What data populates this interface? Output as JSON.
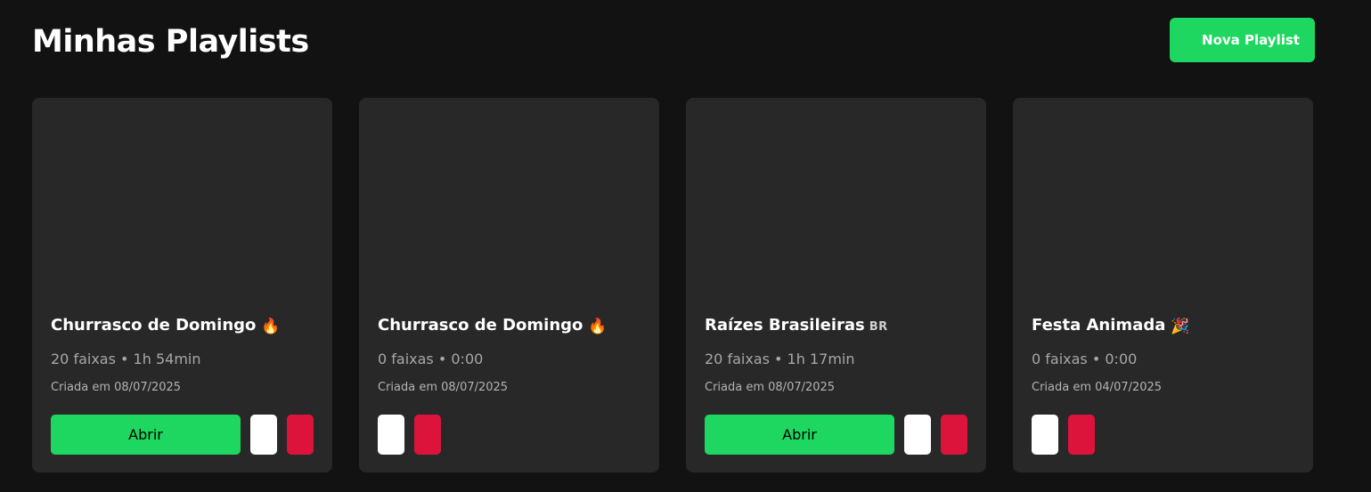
{
  "header": {
    "title": "Minhas Playlists",
    "new_playlist_label": "Nova Playlist"
  },
  "colors": {
    "background": "#121212",
    "card": "#282828",
    "accent": "#1ed760",
    "danger": "#dc143c",
    "edit": "#ffffff"
  },
  "playlists": [
    {
      "name": "Churrasco de Domingo",
      "emoji": "🔥",
      "meta": "20 faixas • 1h 54min",
      "created": "Criada em 08/07/2025",
      "open_label": "Abrir"
    },
    {
      "name": "Churrasco de Domingo",
      "emoji": "🔥",
      "meta": "0 faixas • 0:00",
      "created": "Criada em 08/07/2025"
    },
    {
      "name": "Raízes Brasileiras",
      "emoji": "BR",
      "meta": "20 faixas • 1h 17min",
      "created": "Criada em 08/07/2025",
      "open_label": "Abrir"
    },
    {
      "name": "Festa Animada",
      "emoji": "🎉",
      "meta": "0 faixas • 0:00",
      "created": "Criada em 04/07/2025"
    }
  ]
}
